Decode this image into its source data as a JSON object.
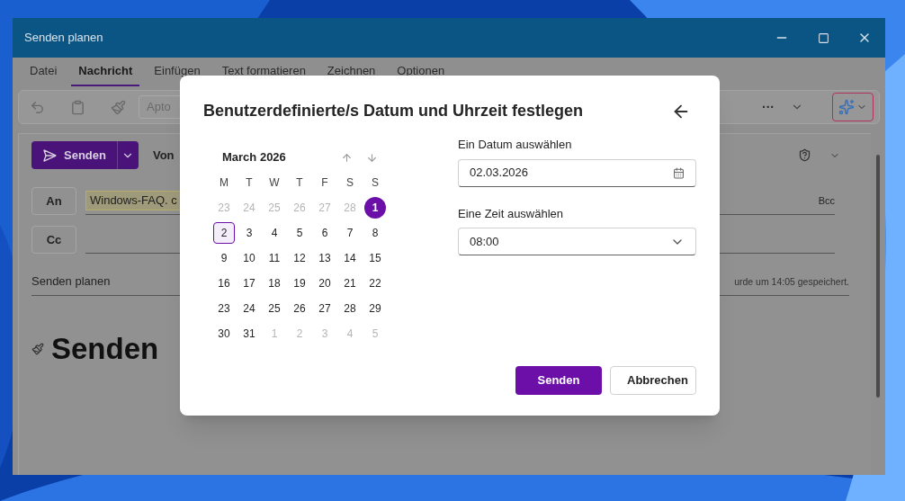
{
  "window": {
    "title": "Senden planen"
  },
  "tabs": [
    {
      "label": "Datei",
      "selected": false
    },
    {
      "label": "Nachricht",
      "selected": true
    },
    {
      "label": "Einfügen",
      "selected": false
    },
    {
      "label": "Text formatieren",
      "selected": false
    },
    {
      "label": "Zeichnen",
      "selected": false
    },
    {
      "label": "Optionen",
      "selected": false
    }
  ],
  "toolbar": {
    "font_field": "Apto",
    "more": "···"
  },
  "compose": {
    "send_button": "Senden",
    "from_label": "Von",
    "to_button": "An",
    "to_value": "Windows-FAQ. c",
    "cc_button": "Cc",
    "bcc": "Bcc",
    "subject": "Senden planen",
    "saved_note": "urde um 14:05 gespeichert.",
    "body_heading": "Senden"
  },
  "dialog": {
    "title": "Benutzerdefinierte/s Datum und Uhrzeit festlegen",
    "calendar": {
      "month": "March 2026",
      "weekdays": [
        "M",
        "T",
        "W",
        "T",
        "F",
        "S",
        "S"
      ],
      "weeks": [
        [
          {
            "day": "23",
            "outside": true,
            "today": false,
            "selected": false
          },
          {
            "day": "24",
            "outside": true,
            "today": false,
            "selected": false
          },
          {
            "day": "25",
            "outside": true,
            "today": false,
            "selected": false
          },
          {
            "day": "26",
            "outside": true,
            "today": false,
            "selected": false
          },
          {
            "day": "27",
            "outside": true,
            "today": false,
            "selected": false
          },
          {
            "day": "28",
            "outside": true,
            "today": false,
            "selected": false
          },
          {
            "day": "1",
            "outside": false,
            "today": true,
            "selected": false
          }
        ],
        [
          {
            "day": "2",
            "outside": false,
            "today": false,
            "selected": true
          },
          {
            "day": "3",
            "outside": false,
            "today": false,
            "selected": false
          },
          {
            "day": "4",
            "outside": false,
            "today": false,
            "selected": false
          },
          {
            "day": "5",
            "outside": false,
            "today": false,
            "selected": false
          },
          {
            "day": "6",
            "outside": false,
            "today": false,
            "selected": false
          },
          {
            "day": "7",
            "outside": false,
            "today": false,
            "selected": false
          },
          {
            "day": "8",
            "outside": false,
            "today": false,
            "selected": false
          }
        ],
        [
          {
            "day": "9",
            "outside": false,
            "today": false,
            "selected": false
          },
          {
            "day": "10",
            "outside": false,
            "today": false,
            "selected": false
          },
          {
            "day": "11",
            "outside": false,
            "today": false,
            "selected": false
          },
          {
            "day": "12",
            "outside": false,
            "today": false,
            "selected": false
          },
          {
            "day": "13",
            "outside": false,
            "today": false,
            "selected": false
          },
          {
            "day": "14",
            "outside": false,
            "today": false,
            "selected": false
          },
          {
            "day": "15",
            "outside": false,
            "today": false,
            "selected": false
          }
        ],
        [
          {
            "day": "16",
            "outside": false,
            "today": false,
            "selected": false
          },
          {
            "day": "17",
            "outside": false,
            "today": false,
            "selected": false
          },
          {
            "day": "18",
            "outside": false,
            "today": false,
            "selected": false
          },
          {
            "day": "19",
            "outside": false,
            "today": false,
            "selected": false
          },
          {
            "day": "20",
            "outside": false,
            "today": false,
            "selected": false
          },
          {
            "day": "21",
            "outside": false,
            "today": false,
            "selected": false
          },
          {
            "day": "22",
            "outside": false,
            "today": false,
            "selected": false
          }
        ],
        [
          {
            "day": "23",
            "outside": false,
            "today": false,
            "selected": false
          },
          {
            "day": "24",
            "outside": false,
            "today": false,
            "selected": false
          },
          {
            "day": "25",
            "outside": false,
            "today": false,
            "selected": false
          },
          {
            "day": "26",
            "outside": false,
            "today": false,
            "selected": false
          },
          {
            "day": "27",
            "outside": false,
            "today": false,
            "selected": false
          },
          {
            "day": "28",
            "outside": false,
            "today": false,
            "selected": false
          },
          {
            "day": "29",
            "outside": false,
            "today": false,
            "selected": false
          }
        ],
        [
          {
            "day": "30",
            "outside": false,
            "today": false,
            "selected": false
          },
          {
            "day": "31",
            "outside": false,
            "today": false,
            "selected": false
          },
          {
            "day": "1",
            "outside": true,
            "today": false,
            "selected": false
          },
          {
            "day": "2",
            "outside": true,
            "today": false,
            "selected": false
          },
          {
            "day": "3",
            "outside": true,
            "today": false,
            "selected": false
          },
          {
            "day": "4",
            "outside": true,
            "today": false,
            "selected": false
          },
          {
            "day": "5",
            "outside": true,
            "today": false,
            "selected": false
          }
        ]
      ]
    },
    "date_label": "Ein Datum auswählen",
    "date_value": "02.03.2026",
    "time_label": "Eine Zeit auswählen",
    "time_value": "08:00",
    "buttons": [
      {
        "label": "Senden",
        "kind": "primary"
      },
      {
        "label": "Abbrechen",
        "kind": "secondary"
      }
    ]
  }
}
